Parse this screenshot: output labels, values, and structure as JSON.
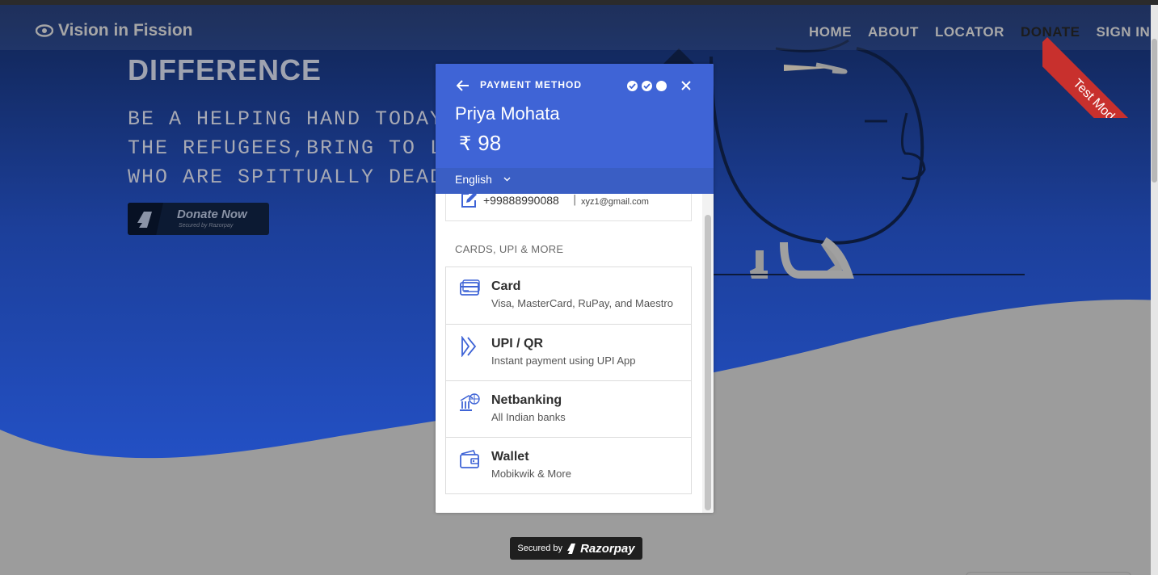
{
  "site": {
    "brand": "Vision in Fission",
    "nav": [
      "HOME",
      "ABOUT",
      "LOCATOR",
      "DONATE",
      "SIGN IN"
    ],
    "hero_title": "DIFFERENCE",
    "hero_text": "BE A HELPING HAND TODAY.WE\nTHE REFUGEES,BRING TO LIFE\nWHO ARE SPITTUALLY DEAD.",
    "donate_button": {
      "label": "Donate Now",
      "sub": "Secured by Razorpay"
    },
    "ribbon": "Test Mode"
  },
  "checkout": {
    "header_title": "PAYMENT METHOD",
    "merchant_name": "Priya Mohata",
    "currency_symbol": "₹",
    "amount": "98",
    "language": "English",
    "contact": {
      "phone": "+99888990088",
      "separator": "|",
      "email": "xyz1@gmail.com"
    },
    "section_title": "CARDS, UPI & MORE",
    "methods": [
      {
        "name": "Card",
        "desc": "Visa, MasterCard, RuPay, and Maestro",
        "icon": "card-icon"
      },
      {
        "name": "UPI / QR",
        "desc": "Instant payment using UPI App",
        "icon": "upi-icon"
      },
      {
        "name": "Netbanking",
        "desc": "All Indian banks",
        "icon": "bank-icon"
      },
      {
        "name": "Wallet",
        "desc": "Mobikwik & More",
        "icon": "wallet-icon"
      }
    ],
    "steps_completed": 2,
    "steps_total": 3
  },
  "footer": {
    "secured_by": "Secured by",
    "brand": "Razorpay"
  },
  "colors": {
    "header_blue": "#3f64d6",
    "site_blue": "#2350c4",
    "icon_blue": "#3f64d6",
    "ribbon_red": "#c8302d"
  }
}
